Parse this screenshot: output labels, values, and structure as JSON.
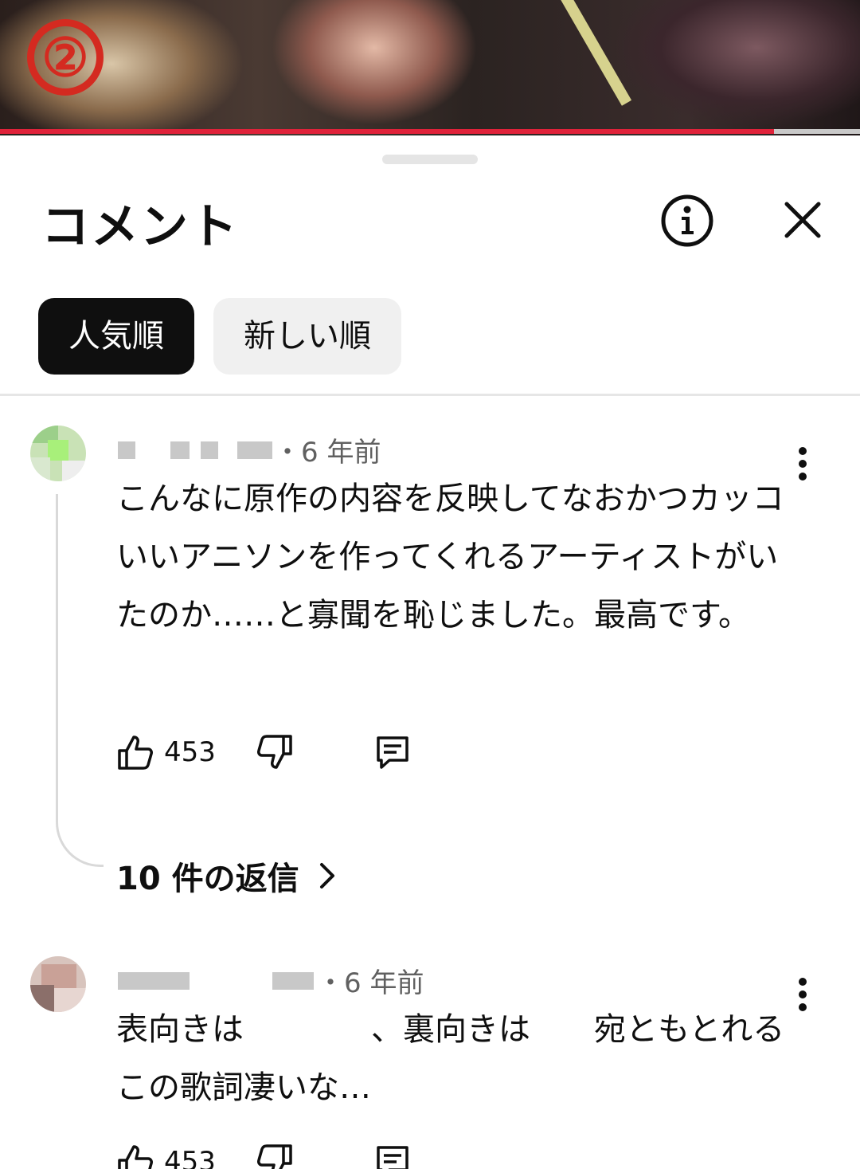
{
  "video": {
    "badge": "②",
    "progress_fraction": 0.9
  },
  "header": {
    "title": "コメント",
    "info_icon": "info-circle-icon",
    "close_icon": "close-icon"
  },
  "sort_chips": [
    {
      "label": "人気順",
      "active": true
    },
    {
      "label": "新しい順",
      "active": false
    }
  ],
  "comments": [
    {
      "time": "・6 年前",
      "text": "こんなに原作の内容を反映してなおかつカッコいいアニソンを作ってくれるアーティストがいたのか……と寡聞を恥じました。最高です。",
      "likes": "453",
      "replies_label": "10 件の返信"
    },
    {
      "time": "・6 年前",
      "text": "表向きは　　　　、裏向きは　　宛ともとれるこの歌詞凄いな…",
      "likes": "453"
    }
  ],
  "colors": {
    "accent": "#e0223a",
    "chip_active": "#0f0f0f",
    "chip_inactive": "#f0f0f0",
    "badge": "#d42a20"
  }
}
